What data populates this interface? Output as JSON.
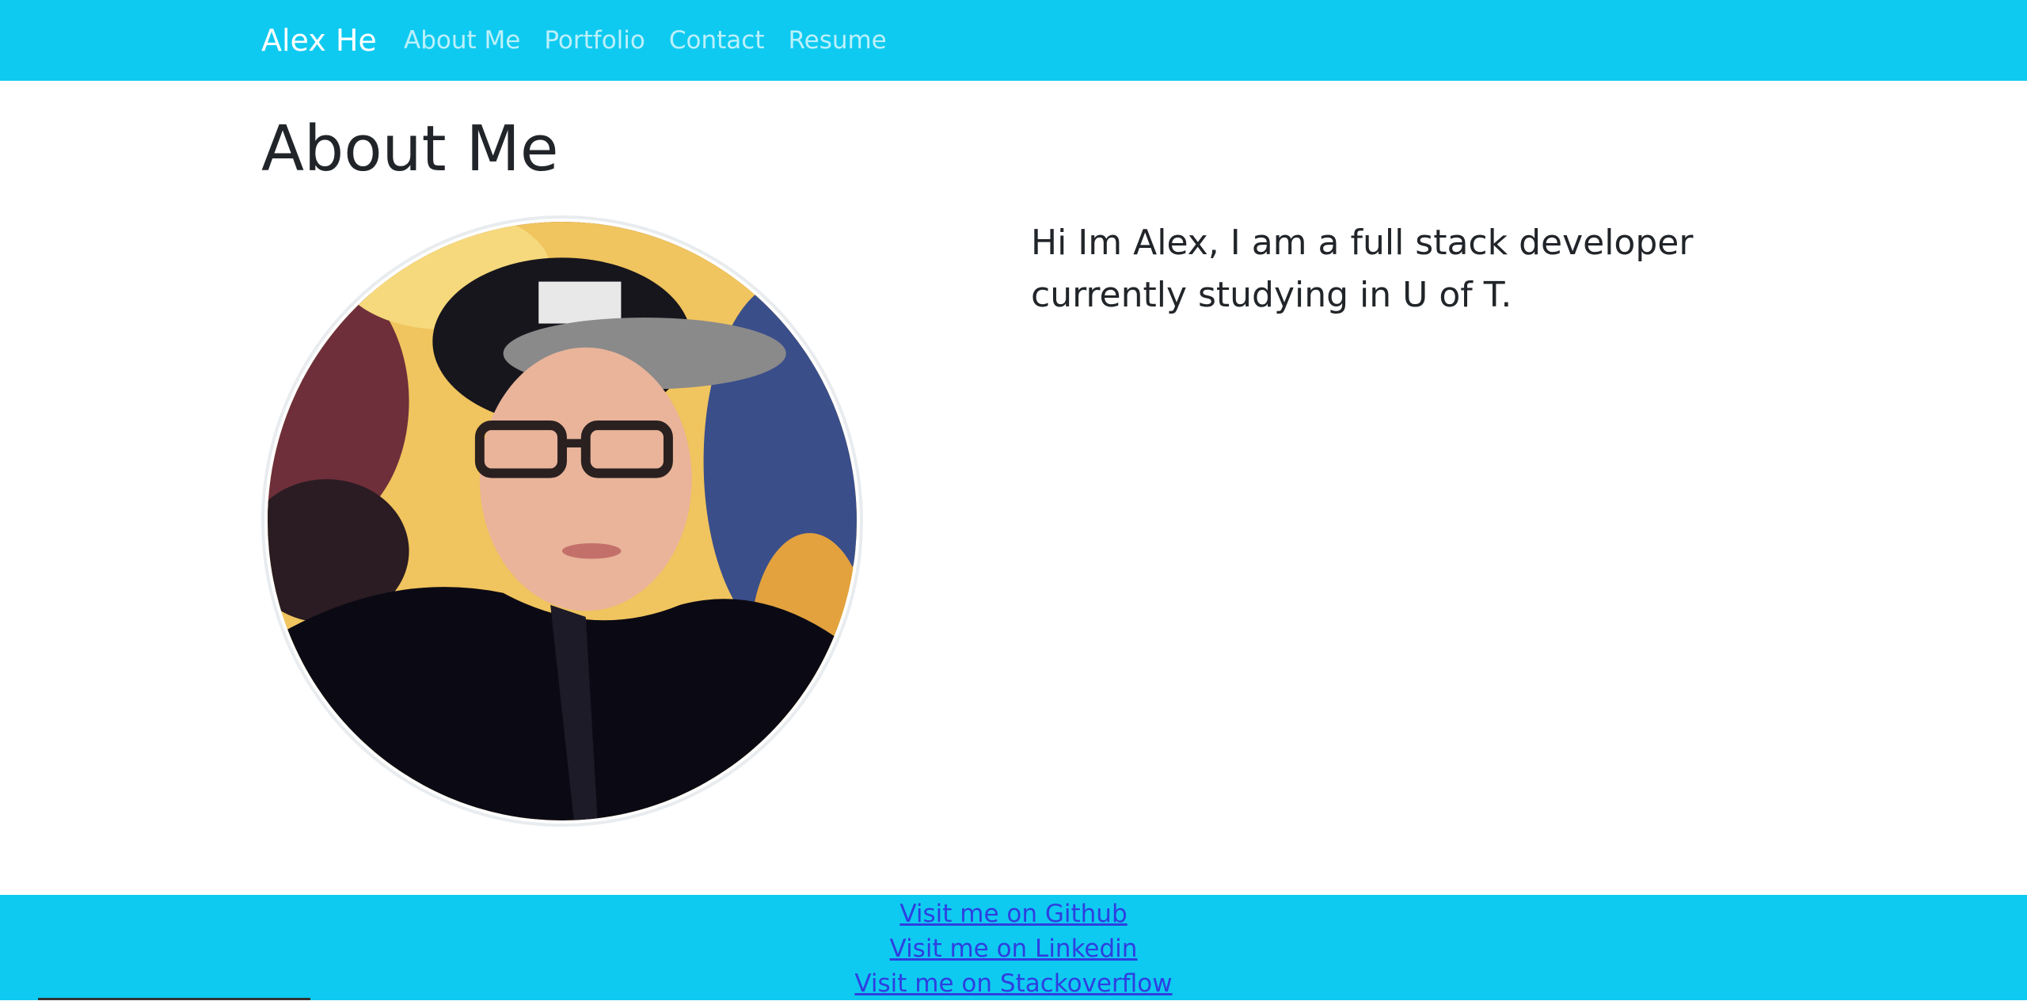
{
  "theme": {
    "accent": "#0fcaf0",
    "link_color": "#2e3fe0"
  },
  "navbar": {
    "brand": "Alex He",
    "links": [
      {
        "label": "About Me"
      },
      {
        "label": "Portfolio"
      },
      {
        "label": "Contact"
      },
      {
        "label": "Resume"
      }
    ]
  },
  "main": {
    "title": "About Me",
    "bio": "Hi Im Alex, I am a full stack developer currently studying in U of T."
  },
  "footer": {
    "links": [
      {
        "label": "Visit me on Github"
      },
      {
        "label": "Visit me on Linkedin"
      },
      {
        "label": "Visit me on Stackoverflow"
      }
    ]
  }
}
